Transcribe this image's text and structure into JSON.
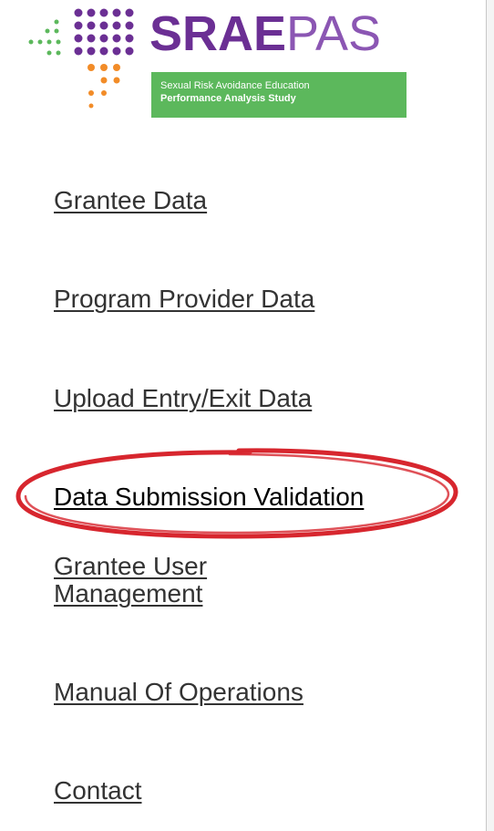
{
  "logo": {
    "title_strong": "SRAE",
    "title_light": "PAS",
    "subtitle_line1": "Sexual Risk Avoidance Education",
    "subtitle_line2": "Performance Analysis Study",
    "colors": {
      "purple": "#6b2f94",
      "orange": "#f28c28",
      "green": "#5cb85c"
    }
  },
  "nav": {
    "items": [
      {
        "label": "Grantee Data"
      },
      {
        "label": "Program Provider Data"
      },
      {
        "label": "Upload Entry/Exit Data"
      },
      {
        "label": "Data Submission Validation",
        "active": true
      },
      {
        "label": "Grantee User Management"
      },
      {
        "label": "Manual Of Operations"
      },
      {
        "label": "Contact"
      }
    ]
  },
  "highlight": {
    "color": "#d7262e",
    "target": "Data Submission Validation"
  }
}
